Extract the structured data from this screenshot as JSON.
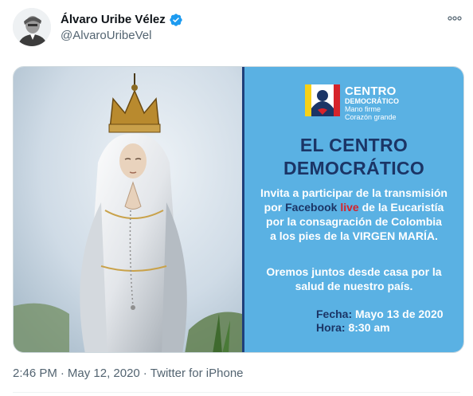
{
  "tweet": {
    "display_name": "Álvaro Uribe Vélez",
    "handle": "@AlvaroUribeVel",
    "more_icon": "ellipsis-icon",
    "verified_icon": "verified-badge-icon"
  },
  "image": {
    "logo": {
      "line1": "CENTRO",
      "line2": "DEMOCRÁTICO",
      "line3": "Mano firme",
      "line4": "Corazón grande"
    },
    "headline_line1": "EL CENTRO",
    "headline_line2": "DEMOCRÁTICO",
    "body": {
      "line1": "Invita a participar de la transmisión",
      "line2_pre": "por ",
      "line2_fb": "Facebook",
      "line2_live": "live",
      "line2_post": " de la Eucaristía",
      "line3": "por la consagración de Colombia",
      "line4": "a los pies de la VIRGEN MARÍA."
    },
    "pray_line1": "Oremos juntos desde casa por la",
    "pray_line2": "salud de nuestro país.",
    "fecha_label": "Fecha:",
    "fecha_value": "Mayo 13 de 2020",
    "hora_label": "Hora:",
    "hora_value": "8:30 am"
  },
  "footer": {
    "time": "2:46 PM",
    "sep1": "·",
    "date": "May 12, 2020",
    "sep2": "·",
    "source": "Twitter for iPhone"
  },
  "colors": {
    "accent_blue": "#1d9bf0",
    "poster_blue": "#5ab1e3",
    "poster_navy": "#1b3566",
    "live_red": "#d6232a"
  }
}
